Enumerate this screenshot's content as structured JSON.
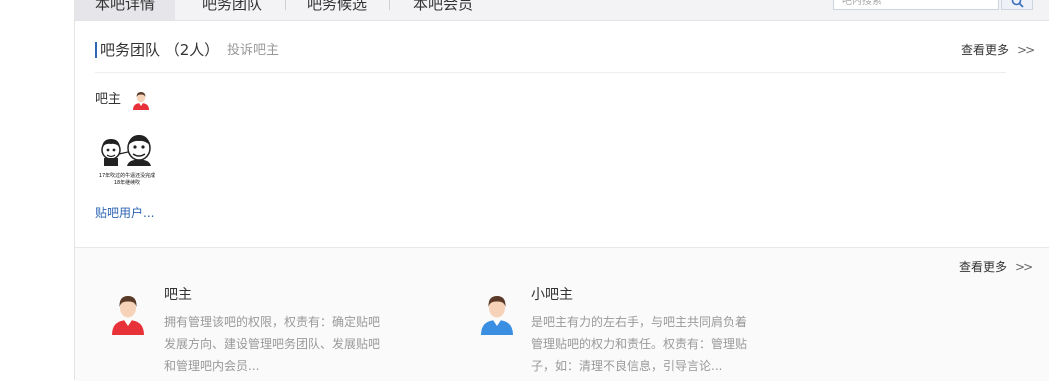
{
  "tabs": [
    {
      "label": "本吧详情",
      "active": true
    },
    {
      "label": "吧务团队",
      "active": false
    },
    {
      "label": "吧务候选",
      "active": false
    },
    {
      "label": "本吧会员",
      "active": false
    }
  ],
  "search": {
    "placeholder": "吧内搜索",
    "icon": "search-icon"
  },
  "team": {
    "title": "吧务团队 （2人）",
    "complain": "投诉吧主",
    "more": "查看更多",
    "owner_label": "吧主",
    "meme_caption_line1": "17年吹过的牛逼还没完成",
    "meme_caption_line2": "18年继续吹",
    "user_name": "贴吧用户..."
  },
  "roles": {
    "more": "查看更多",
    "items": [
      {
        "title": "吧主",
        "desc": "拥有管理该吧的权限，权责有：确定贴吧发展方向、建设管理吧务团队、发展贴吧和管理吧内会员...",
        "color": "#e8323a"
      },
      {
        "title": "小吧主",
        "desc": "是吧主有力的左右手，与吧主共同肩负着管理贴吧的权力和责任。权责有：管理贴子，如：清理不良信息，引导言论...",
        "color": "#3a8fe3"
      }
    ]
  },
  "colors": {
    "accent": "#2d64b3",
    "owner_red": "#e8323a",
    "assistant_blue": "#3a8fe3"
  }
}
